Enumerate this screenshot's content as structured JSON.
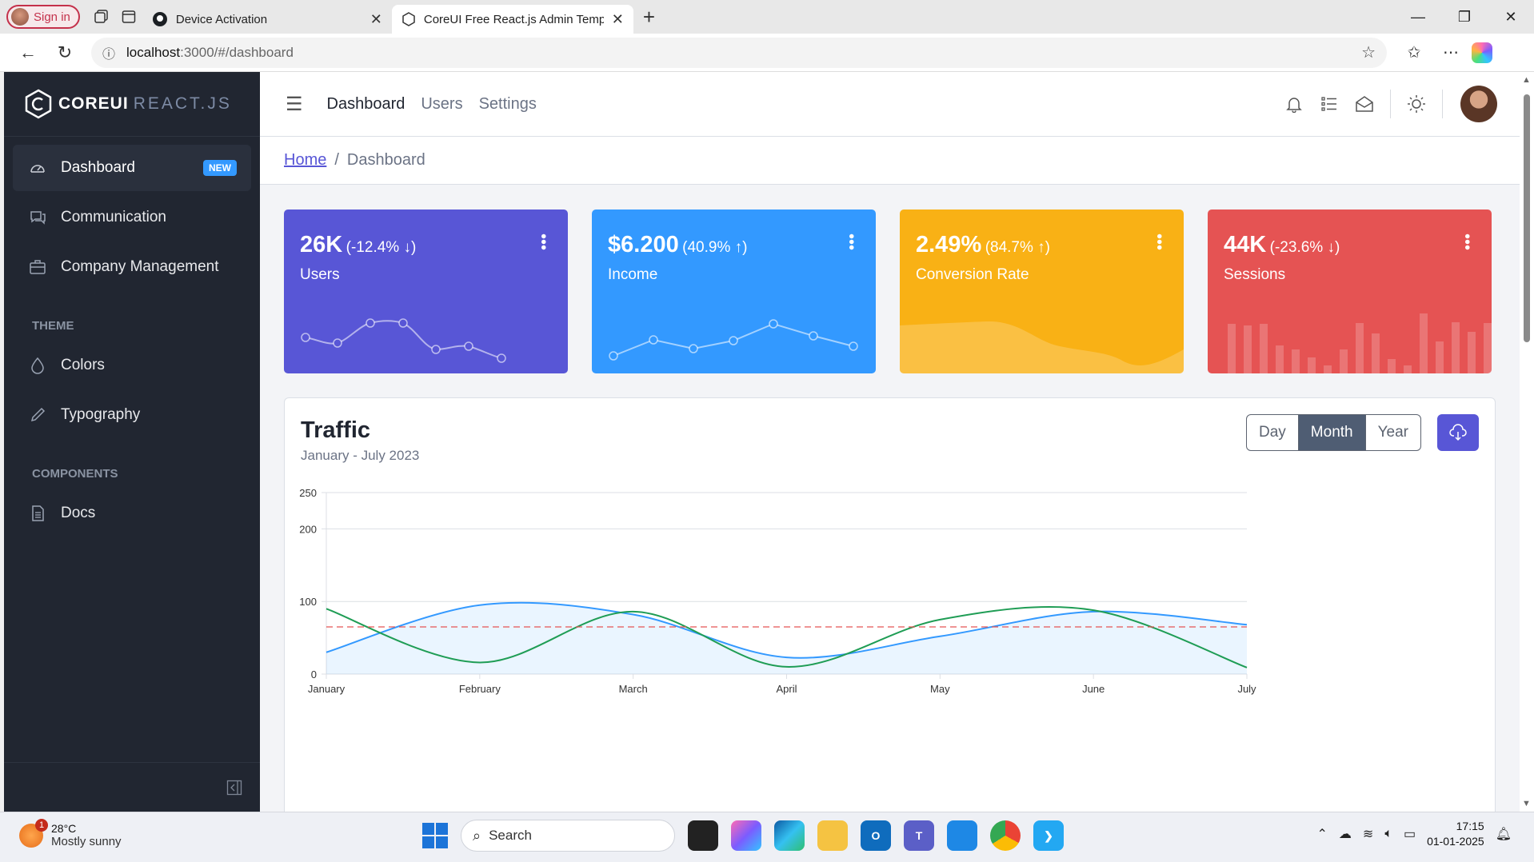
{
  "browser": {
    "signin_label": "Sign in",
    "tabs": [
      {
        "title": "Device Activation"
      },
      {
        "title": "CoreUI Free React.js Admin Templ"
      }
    ],
    "url_host": "localhost",
    "url_path": ":3000/#/dashboard"
  },
  "brand": {
    "core": "COREUI",
    "react": "REACT.JS"
  },
  "sidebar": {
    "items": [
      {
        "label": "Dashboard",
        "badge": "NEW"
      },
      {
        "label": "Communication"
      },
      {
        "label": "Company Management"
      }
    ],
    "theme_title": "THEME",
    "theme_items": [
      {
        "label": "Colors"
      },
      {
        "label": "Typography"
      }
    ],
    "components_title": "COMPONENTS",
    "components_items": [
      {
        "label": "Docs"
      }
    ]
  },
  "header": {
    "links": [
      {
        "label": "Dashboard"
      },
      {
        "label": "Users"
      },
      {
        "label": "Settings"
      }
    ]
  },
  "breadcrumb": {
    "home": "Home",
    "sep": "/",
    "current": "Dashboard"
  },
  "widgets": [
    {
      "value": "26K",
      "change": "(-12.4% ↓)",
      "label": "Users",
      "color": "#5856d6"
    },
    {
      "value": "$6.200",
      "change": "(40.9% ↑)",
      "label": "Income",
      "color": "#3399ff"
    },
    {
      "value": "2.49%",
      "change": "(84.7% ↑)",
      "label": "Conversion Rate",
      "color": "#f9b115"
    },
    {
      "value": "44K",
      "change": "(-23.6% ↓)",
      "label": "Sessions",
      "color": "#e55353"
    }
  ],
  "traffic": {
    "title": "Traffic",
    "subtitle": "January - July 2023",
    "segments": [
      "Day",
      "Month",
      "Year"
    ],
    "selected_segment": "Month"
  },
  "chart_data": {
    "type": "line",
    "categories": [
      "January",
      "February",
      "March",
      "April",
      "May",
      "June",
      "July"
    ],
    "ylim": [
      0,
      250
    ],
    "yticks": [
      0,
      100,
      200,
      250
    ],
    "series": [
      {
        "values": [
          30,
          95,
          82,
          23,
          52,
          86,
          68
        ],
        "color": "#3399ff",
        "fill": true
      },
      {
        "values": [
          90,
          16,
          86,
          10,
          75,
          88,
          9
        ],
        "color": "#1f9d55"
      },
      {
        "values": [
          65,
          65,
          65,
          65,
          65,
          65,
          65
        ],
        "color": "#e55353",
        "dashed": true
      }
    ],
    "grid": true
  },
  "taskbar": {
    "temp": "28°C",
    "weather": "Mostly sunny",
    "weather_badge": "1",
    "search_placeholder": "Search",
    "time": "17:15",
    "date": "01-01-2025"
  }
}
